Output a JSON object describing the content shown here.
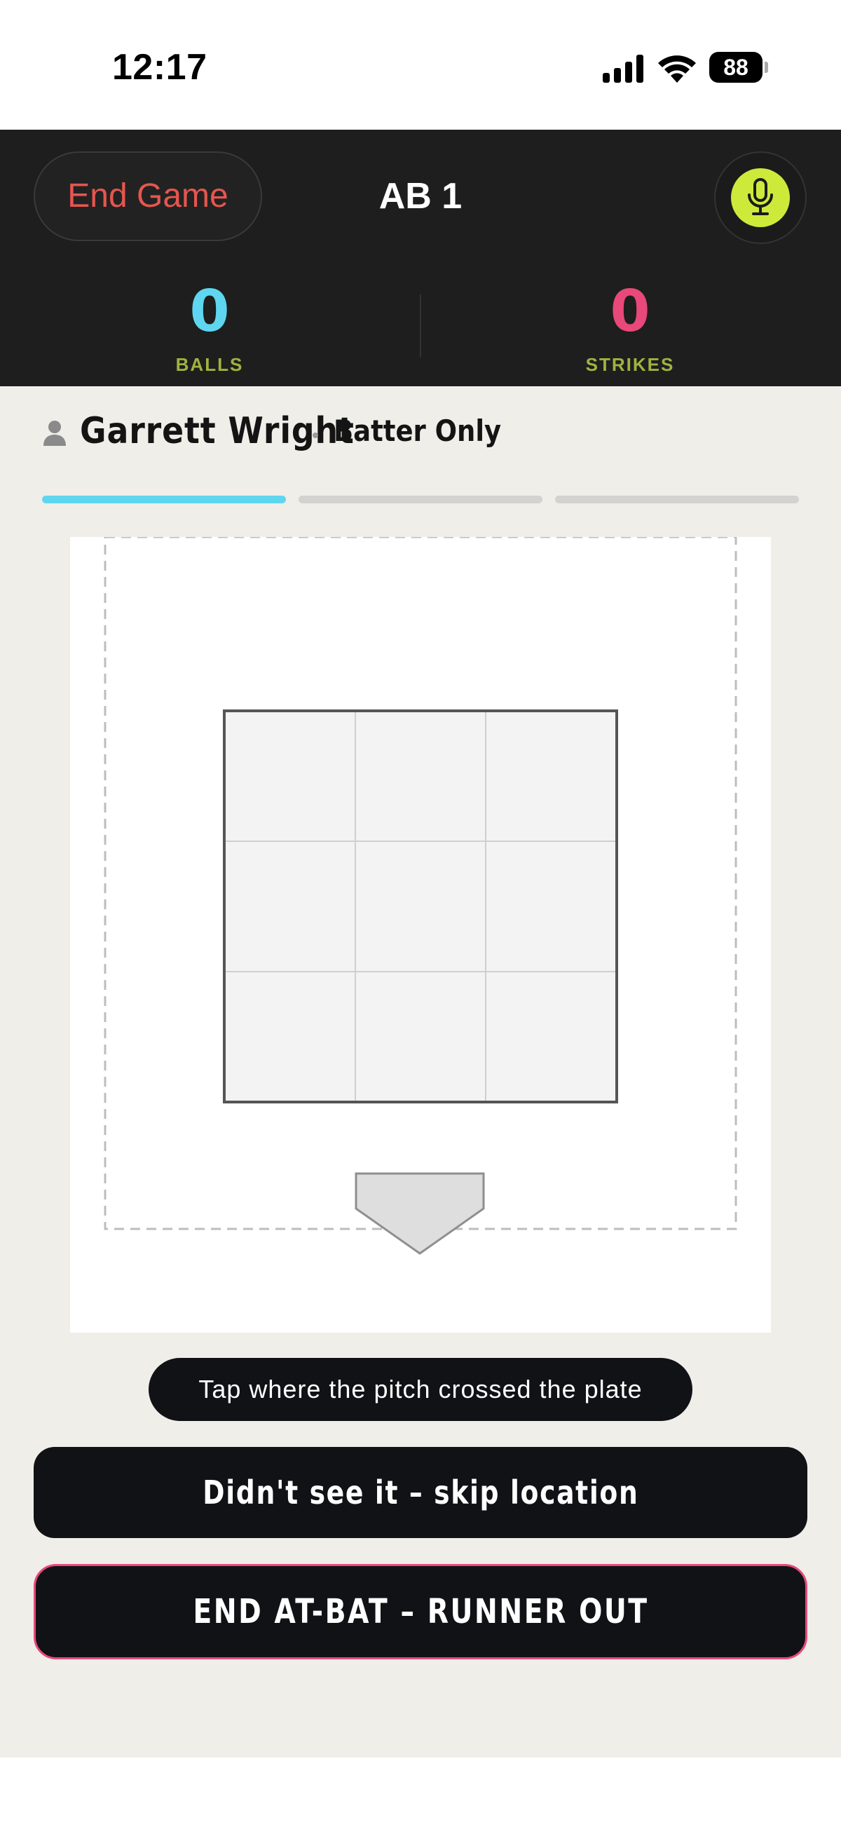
{
  "status_bar": {
    "time": "12:17",
    "battery": "88",
    "icons": [
      "cellular-signal-icon",
      "wifi-icon",
      "battery-icon"
    ]
  },
  "header": {
    "end_game_label": "End Game",
    "title": "AB 1",
    "mic_icon": "microphone-icon",
    "balls": {
      "value": "0",
      "label": "BALLS"
    },
    "strikes": {
      "value": "0",
      "label": "STRIKES"
    }
  },
  "batter": {
    "icon": "person-icon",
    "name": "Garrett Wright",
    "mode": "Batter Only"
  },
  "progress": {
    "steps": 3,
    "active_step": 1
  },
  "pitch_location": {
    "zone_grid": "3x3",
    "plate_icon": "home-plate-icon"
  },
  "hint": "Tap where the pitch crossed the plate",
  "buttons": {
    "skip_location": "Didn't see it – skip location",
    "end_at_bat": "END AT-BAT – RUNNER OUT"
  },
  "colors": {
    "header_bg": "#1e1e1e",
    "end_game_text": "#e5564f",
    "mic_accent": "#cdea3b",
    "balls": "#5fd6ef",
    "strikes": "#e8487a",
    "count_label": "#9fb340",
    "page_bg": "#efeee9",
    "button_bg": "#111216"
  }
}
